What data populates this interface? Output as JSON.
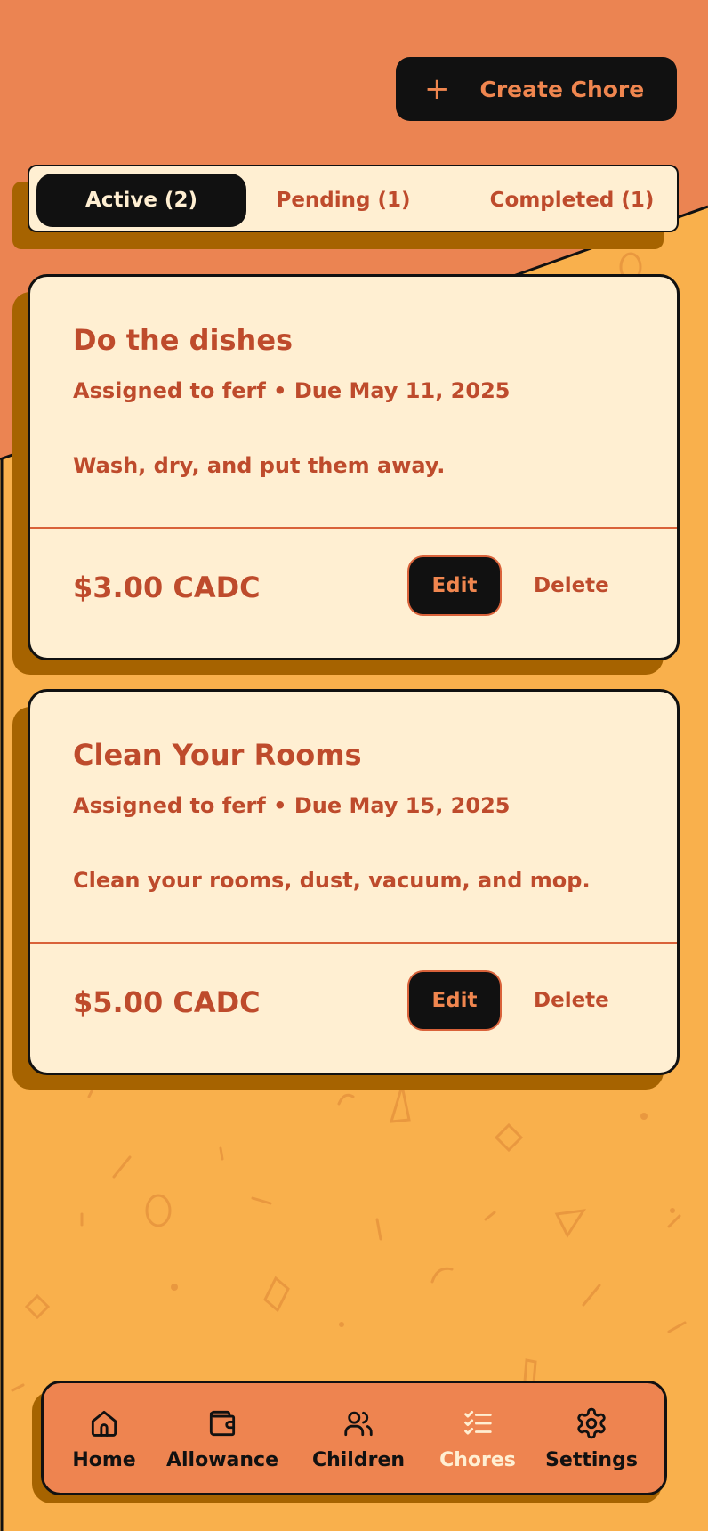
{
  "colors": {
    "top_background": "#EB8452",
    "page_background": "#F9B04C",
    "card_background": "#FFEFD2",
    "accent_text": "#BE4B2C",
    "shadow": "#A66300",
    "dark": "#111111"
  },
  "header": {
    "create_label": "Create Chore",
    "create_icon": "plus-icon"
  },
  "tabs": [
    {
      "label": "Active (2)",
      "active": true
    },
    {
      "label": "Pending (1)",
      "active": false
    },
    {
      "label": "Completed (1)",
      "active": false
    }
  ],
  "chores": [
    {
      "title": "Do the dishes",
      "meta": "Assigned to ferf • Due May 11, 2025",
      "description": "Wash, dry, and put them away.",
      "amount": "$3.00 CADC",
      "edit_label": "Edit",
      "delete_label": "Delete"
    },
    {
      "title": "Clean Your Rooms",
      "meta": "Assigned to ferf • Due May 15, 2025",
      "description": "Clean your rooms, dust, vacuum, and mop.",
      "amount": "$5.00 CADC",
      "edit_label": "Edit",
      "delete_label": "Delete"
    }
  ],
  "nav": [
    {
      "label": "Home",
      "icon": "home-icon",
      "active": false
    },
    {
      "label": "Allowance",
      "icon": "wallet-icon",
      "active": false
    },
    {
      "label": "Children",
      "icon": "users-icon",
      "active": false
    },
    {
      "label": "Chores",
      "icon": "checklist-icon",
      "active": true
    },
    {
      "label": "Settings",
      "icon": "gear-icon",
      "active": false
    }
  ]
}
